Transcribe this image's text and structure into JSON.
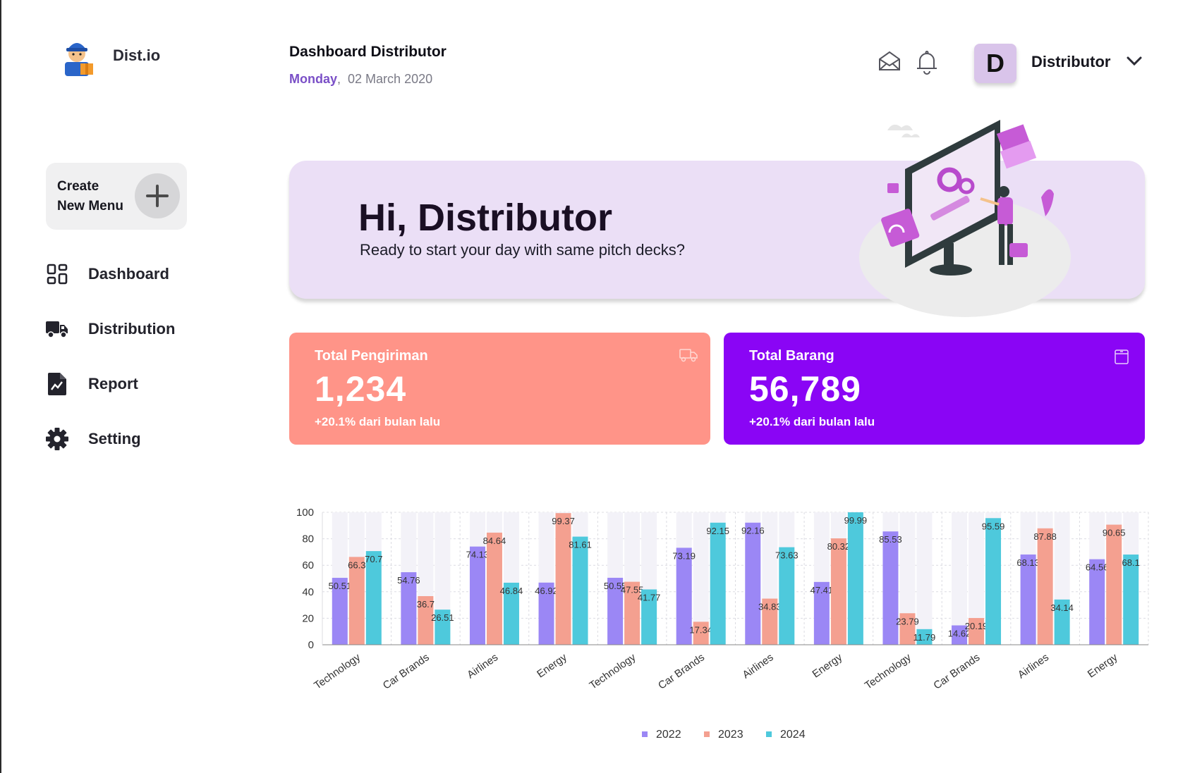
{
  "app": {
    "name": "Dist.io"
  },
  "sidebar": {
    "create_label": "Create\nNew Menu",
    "items": [
      {
        "label": "Dashboard",
        "icon": "grid-icon"
      },
      {
        "label": "Distribution",
        "icon": "truck-icon"
      },
      {
        "label": "Report",
        "icon": "report-icon"
      },
      {
        "label": "Setting",
        "icon": "gear-icon"
      }
    ]
  },
  "header": {
    "title": "Dashboard Distributor",
    "day": "Monday",
    "date": "02 March 2020",
    "user_initial": "D",
    "user_name": "Distributor"
  },
  "hero": {
    "title": "Hi, Distributor",
    "subtitle": "Ready to start your day with same pitch decks?"
  },
  "cards": [
    {
      "title": "Total Pengiriman",
      "value": "1,234",
      "foot": "+20.1% dari bulan lalu",
      "color": "#ff9488",
      "icon": "truck-icon"
    },
    {
      "title": "Total Barang",
      "value": "56,789",
      "foot": "+20.1% dari bulan lalu",
      "color": "#8a05f5",
      "icon": "box-icon"
    }
  ],
  "colors": {
    "accent": "#7a4fc7",
    "hero_bg": "#ebdff6"
  },
  "chart_data": {
    "type": "bar",
    "categories": [
      "Technology",
      "Car Brands",
      "Airlines",
      "Energy",
      "Technology",
      "Car Brands",
      "Airlines",
      "Energy",
      "Technology",
      "Car Brands",
      "Airlines",
      "Energy"
    ],
    "series": [
      {
        "name": "2022",
        "color": "#9b87f5",
        "values": [
          50.51,
          54.76,
          74.13,
          46.92,
          50.55,
          73.19,
          92.16,
          47.41,
          85.53,
          14.62,
          68.13,
          64.56
        ]
      },
      {
        "name": "2023",
        "color": "#f4a090",
        "values": [
          66.3,
          36.7,
          84.64,
          99.37,
          47.55,
          17.34,
          34.83,
          80.32,
          23.79,
          20.19,
          87.88,
          90.65
        ]
      },
      {
        "name": "2024",
        "color": "#4ec9dc",
        "values": [
          70.7,
          26.51,
          46.84,
          81.61,
          41.77,
          92.15,
          73.63,
          99.99,
          11.79,
          95.59,
          34.14,
          68.1
        ]
      }
    ],
    "ylim": [
      0,
      100
    ],
    "yticks": [
      0,
      20,
      40,
      60,
      80,
      100
    ],
    "legend": "bottom",
    "grid": true
  }
}
